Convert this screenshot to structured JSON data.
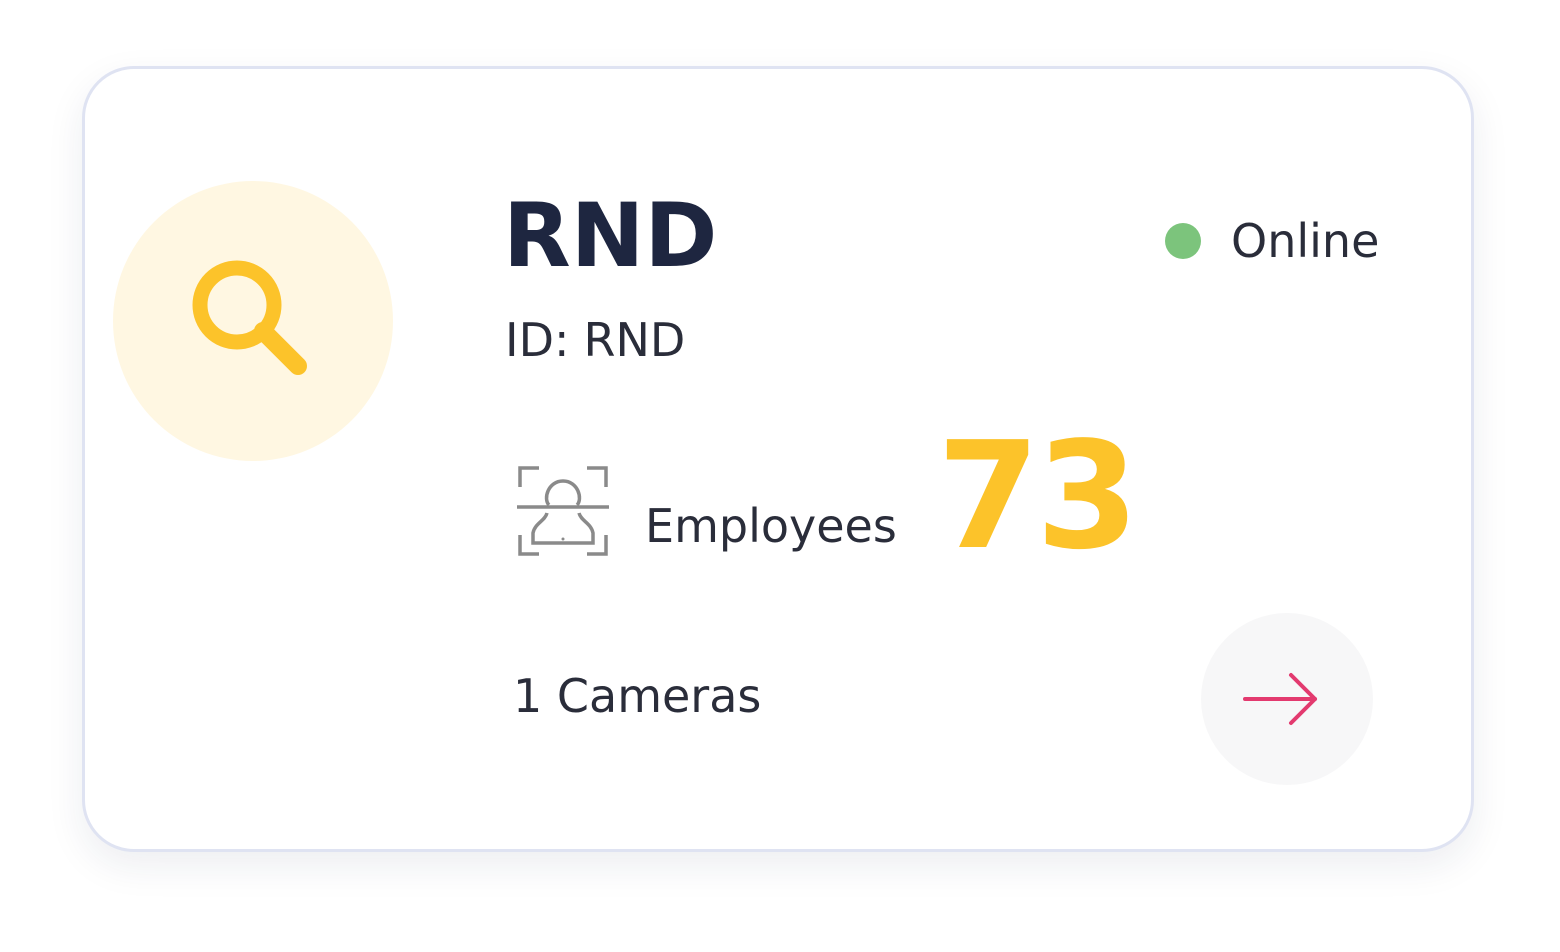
{
  "card": {
    "title": "RND",
    "status": {
      "label": "Online",
      "color": "#7cc47c"
    },
    "id_label": "ID:",
    "id_value": "RND",
    "employees": {
      "label": "Employees",
      "count": "73",
      "icon": "face-scan-icon"
    },
    "cameras_text": "1 Cameras",
    "avatar_icon": "search-icon",
    "action_icon": "arrow-right-icon",
    "colors": {
      "accent": "#fcc32a",
      "avatar_bg": "#fff7e2",
      "arrow": "#e33a6f",
      "title": "#1e2640"
    }
  }
}
